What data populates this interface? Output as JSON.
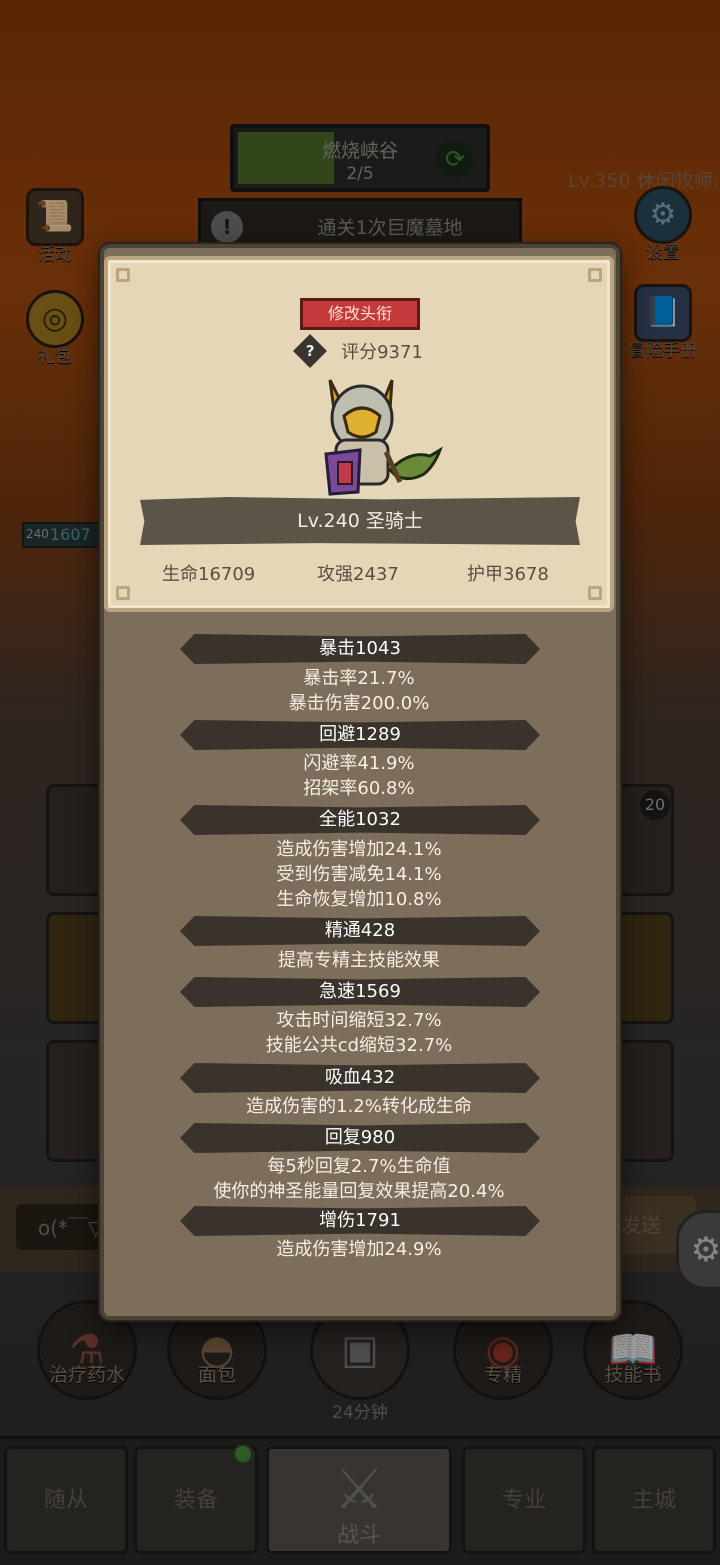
{
  "hud": {
    "stage_title": "燃烧峡谷",
    "stage_progress": "2/5",
    "quest_text": "通关1次巨魔墓地",
    "hero_level_text": "Lv.350 休闲牧师:"
  },
  "side_buttons": {
    "activity": "活动",
    "gift": "礼包",
    "settings": "设置",
    "adventure_manual": "冒险手册"
  },
  "hp_tag": {
    "level": "240",
    "value": "1607"
  },
  "chat": {
    "input_text": "o(*￣▽",
    "send_label": "发送"
  },
  "badge": "20",
  "consumables": {
    "potion": "治疗药水",
    "bread": "面包",
    "timer": "24分钟",
    "specialty": "专精",
    "skill_book": "技能书"
  },
  "nav": {
    "followers": "随从",
    "equipment": "装备",
    "battle": "战斗",
    "profession": "专业",
    "main_city": "主城"
  },
  "profile": {
    "rename_label": "修改头衔",
    "score": "评分9371",
    "class_title": "Lv.240 圣骑士",
    "hp": "生命16709",
    "attack": "攻强2437",
    "armor": "护甲3678"
  },
  "stats": [
    {
      "name": "暴击1043",
      "lines": [
        "暴击率21.7%",
        "暴击伤害200.0%"
      ]
    },
    {
      "name": "回避1289",
      "lines": [
        "闪避率41.9%",
        "招架率60.8%"
      ]
    },
    {
      "name": "全能1032",
      "lines": [
        "造成伤害增加24.1%",
        "受到伤害减免14.1%",
        "生命恢复增加10.8%"
      ]
    },
    {
      "name": "精通428",
      "lines": [
        "提高专精主技能效果"
      ]
    },
    {
      "name": "急速1569",
      "lines": [
        "攻击时间缩短32.7%",
        "技能公共cd缩短32.7%"
      ]
    },
    {
      "name": "吸血432",
      "lines": [
        "造成伤害的1.2%转化成生命"
      ]
    },
    {
      "name": "回复980",
      "lines": [
        "每5秒回复2.7%生命值",
        "使你的神圣能量回复效果提高20.4%"
      ]
    },
    {
      "name": "增伤1791",
      "lines": [
        "造成伤害增加24.9%"
      ]
    }
  ]
}
